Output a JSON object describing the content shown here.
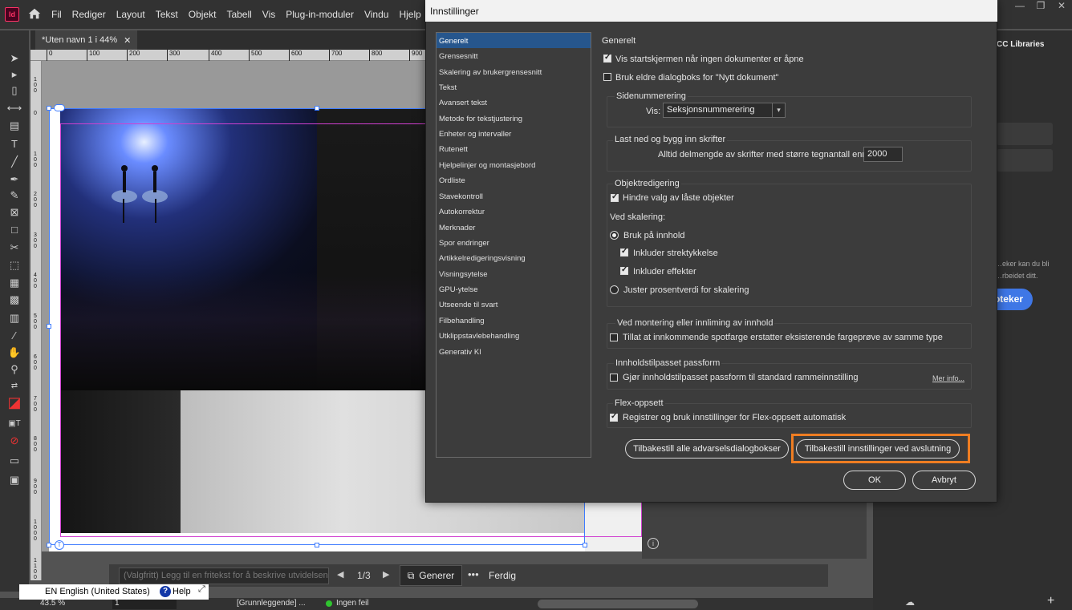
{
  "app": {
    "logo_text": "Id",
    "menu": [
      "Fil",
      "Rediger",
      "Layout",
      "Tekst",
      "Objekt",
      "Tabell",
      "Vis",
      "Plug-in-moduler",
      "Vindu",
      "Hjelp"
    ],
    "window_controls": [
      "—",
      "❐",
      "✕"
    ]
  },
  "document": {
    "tab_title": "*Uten navn 1 i 44%",
    "tab_close": "✕"
  },
  "ruler": {
    "h_ticks": [
      "0",
      "100",
      "200",
      "300",
      "400",
      "500",
      "600",
      "700",
      "800",
      "900"
    ],
    "v_ticks": [
      "1\n0\n0",
      "0",
      "1\n0\n0",
      "2\n0\n0",
      "3\n0\n0",
      "4\n0\n0",
      "5\n0\n0",
      "6\n0\n0",
      "7\n0\n0",
      "8\n0\n0",
      "9\n0\n0",
      "1\n0\n0\n0",
      "1\n1\n0\n0"
    ]
  },
  "right_panel": {
    "tab": "CC Libraries",
    "description": "…eker kan du bli …rbeidet ditt.",
    "button": "…oteker"
  },
  "pagebar": {
    "alt_text_placeholder": "(Valgfritt) Legg til en fritekst for å beskrive utvidelsen",
    "page_indicator": "1/3",
    "generate_label": "Generer",
    "done_label": "Ferdig"
  },
  "statusbar": {
    "zoom": "43.5 %",
    "page": "1",
    "preflight_profile": "[Grunnleggende] ...",
    "errors": "Ingen feil"
  },
  "language_bar": {
    "language": "EN English (United States)",
    "help": "Help"
  },
  "dialog": {
    "title": "Innstillinger",
    "categories": [
      "Generelt",
      "Grensesnitt",
      "Skalering av brukergrensesnitt",
      "Tekst",
      "Avansert tekst",
      "Metode for tekstjustering",
      "Enheter og intervaller",
      "Rutenett",
      "Hjelpelinjer og montasjebord",
      "Ordliste",
      "Stavekontroll",
      "Autokorrektur",
      "Merknader",
      "Spor endringer",
      "Artikkelredigeringsvisning",
      "Visningsytelse",
      "GPU-ytelse",
      "Utseende til svart",
      "Filbehandling",
      "Utklippstavlebehandling",
      "Generativ KI"
    ],
    "selected_category": "Generelt",
    "heading": "Generelt",
    "show_start_screen": "Vis startskjermen når ingen dokumenter er åpne",
    "legacy_new_doc": "Bruk eldre dialogboks for \"Nytt dokument\"",
    "page_numbering": {
      "title": "Sidenummerering",
      "view_label": "Vis:",
      "view_value": "Seksjonsnummerering"
    },
    "fonts": {
      "title": "Last ned og bygg inn skrifter",
      "subset_label": "Alltid delmengde av skrifter med større tegnantall enn:",
      "subset_value": "2000"
    },
    "object_editing": {
      "title": "Objektredigering",
      "prevent_locked": "Hindre valg av låste objekter",
      "when_scaling": "Ved skalering:",
      "apply_to_content": "Bruk på innhold",
      "include_stroke": "Inkluder strektykkelse",
      "include_effects": "Inkluder effekter",
      "adjust_percentage": "Juster prosentverdi for skalering"
    },
    "placing": {
      "title": "Ved montering eller innliming av innhold",
      "allow_spot": "Tillat at innkommende spotfarge erstatter eksisterende fargeprøve av samme type"
    },
    "content_aware": {
      "title": "Innholdstilpasset passform",
      "make_default": "Gjør innholdstilpasset passform til standard rammeinnstilling",
      "more_info": "Mer info..."
    },
    "flex": {
      "title": "Flex-oppsett",
      "register": "Registrer og bruk innstillinger for Flex-oppsett automatisk"
    },
    "reset_warnings": "Tilbakestill alle advarselsdialogbokser",
    "reset_on_quit": "Tilbakestill innstillinger ved avslutning",
    "ok": "OK",
    "cancel": "Avbryt"
  }
}
